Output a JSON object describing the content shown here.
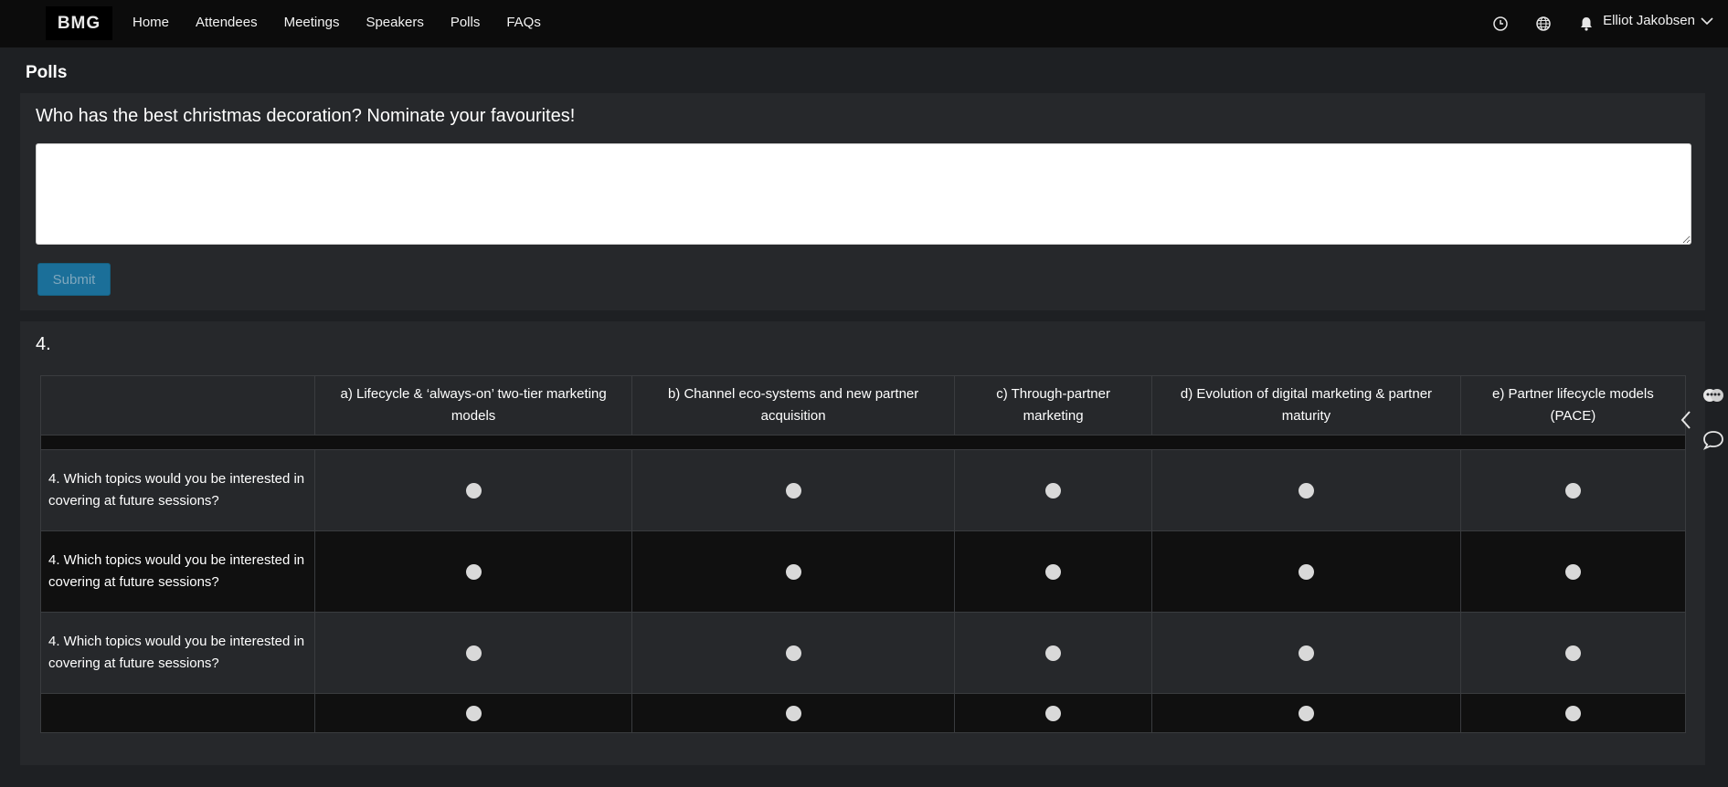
{
  "header": {
    "logo_text": "BMG",
    "nav": [
      "Home",
      "Attendees",
      "Meetings",
      "Speakers",
      "Polls",
      "FAQs"
    ],
    "icons": [
      "clock-icon",
      "globe-icon",
      "bell-icon"
    ],
    "user_name": "Elliot Jakobsen"
  },
  "page_title": "Polls",
  "poll1": {
    "question": "Who has the best christmas decoration? Nominate your favourites!",
    "answer_value": "",
    "submit_label": "Submit"
  },
  "poll2": {
    "number": "4.",
    "columns": [
      "a) Lifecycle & ‘always-on’ two-tier marketing models",
      "b) Channel eco-systems and new partner acquisition",
      "c) Through-partner marketing",
      "d) Evolution of digital marketing & partner maturity",
      "e) Partner lifecycle models (PACE)"
    ],
    "rows": [
      "4. Which topics would you be interested in covering at future sessions?",
      "4. Which topics would you be interested in covering at future sessions?",
      "4. Which topics would you be interested in covering at future sessions?",
      ""
    ]
  },
  "side_icons": [
    "collapse-chevron-icon",
    "attendees-icon",
    "chat-icon"
  ],
  "colors": {
    "background": "#1e2023",
    "card": "#26282b",
    "topbar": "#0c0c0c",
    "submit": "#1b6f99",
    "radio": "#d9d9d9"
  }
}
